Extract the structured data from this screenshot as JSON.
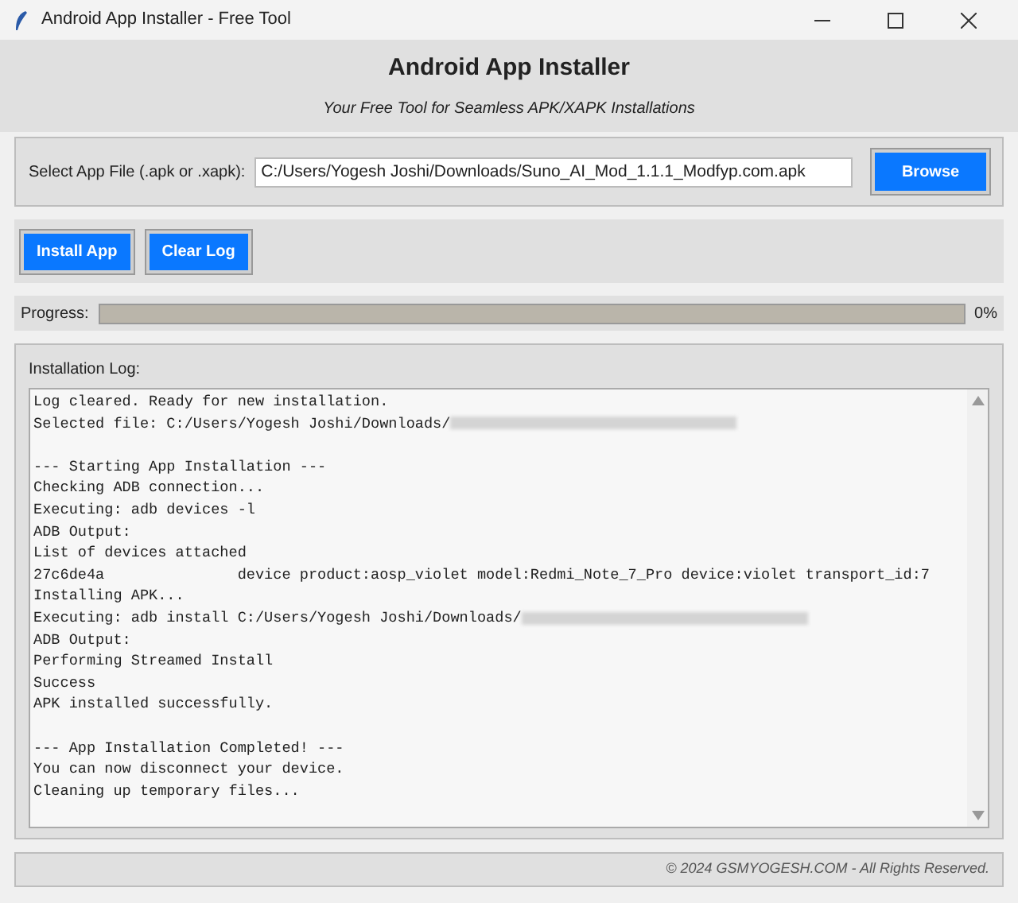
{
  "window": {
    "title": "Android App Installer - Free Tool"
  },
  "header": {
    "title": "Android App Installer",
    "subtitle": "Your Free Tool for Seamless APK/XAPK Installations"
  },
  "file_select": {
    "label": "Select App File (.apk or .xapk):",
    "value": "C:/Users/Yogesh Joshi/Downloads/Suno_AI_Mod_1.1.1_Modfyp.com.apk",
    "button": "Browse"
  },
  "actions": [
    "Install App",
    "Clear Log"
  ],
  "progress": {
    "label": "Progress:",
    "level": 0,
    "reading": "0%"
  },
  "log": {
    "title": "Installation Log:",
    "lines": [
      {
        "text": "Log cleared. Ready for new installation.",
        "redacted": false
      },
      {
        "text": "Selected file: C:/Users/Yogesh Joshi/Downloads/",
        "redacted": true
      },
      {
        "redacted": false
      },
      {
        "text": "--- Starting App Installation ---",
        "redacted": false
      },
      {
        "text": "Checking ADB connection...",
        "redacted": false
      },
      {
        "text": "Executing: adb devices -l",
        "redacted": false
      },
      {
        "text": "ADB Output:",
        "redacted": false
      },
      {
        "text": "List of devices attached",
        "redacted": false
      },
      {
        "text": "27c6de4a               device product:aosp_violet model:Redmi_Note_7_Pro device:violet transport_id:7",
        "redacted": false
      },
      {
        "text": "Installing APK...",
        "redacted": false
      },
      {
        "text": "Executing: adb install C:/Users/Yogesh Joshi/Downloads/",
        "redacted": true
      },
      {
        "text": "ADB Output:",
        "redacted": false
      },
      {
        "text": "Performing Streamed Install",
        "redacted": false
      },
      {
        "text": "Success",
        "redacted": false
      },
      {
        "text": "APK installed successfully.",
        "redacted": false
      },
      {
        "redacted": false
      },
      {
        "text": "--- App Installation Completed! ---",
        "redacted": false
      },
      {
        "text": "You can now disconnect your device.",
        "redacted": false
      },
      {
        "text": "Cleaning up temporary files...",
        "redacted": false
      }
    ]
  },
  "footer": "© 2024 GSMYOGESH.COM - All Rights Reserved."
}
